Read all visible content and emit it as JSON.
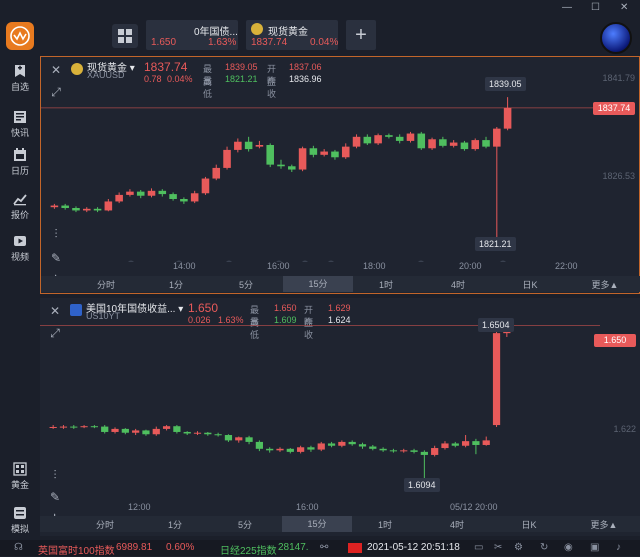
{
  "header": {
    "tabs": [
      {
        "name": "0年国债...",
        "price": "1.650",
        "change": "1.63%"
      },
      {
        "name": "现货黄金",
        "price": "1837.74",
        "change": "0.04%"
      }
    ],
    "add_label": "+"
  },
  "sidebar": {
    "items": [
      {
        "label": "自选",
        "icon": "bookmark-icon"
      },
      {
        "label": "快讯",
        "icon": "news-icon"
      },
      {
        "label": "日历",
        "icon": "calendar-icon"
      },
      {
        "label": "报价",
        "icon": "quote-chart-icon"
      },
      {
        "label": "视频",
        "icon": "video-play-icon"
      },
      {
        "label": "黄金",
        "icon": "gold-grid-icon"
      },
      {
        "label": "模拟",
        "icon": "simulate-icon"
      }
    ]
  },
  "panel1": {
    "name": "现货黄金",
    "code": "XAUUSD",
    "price": "1837.74",
    "change": "0.78",
    "change_pct": "0.04%",
    "high_label": "最高",
    "high": "1839.05",
    "open_label": "开盘",
    "open": "1837.06",
    "low_label": "最低",
    "low": "1821.21",
    "prev_label": "昨收",
    "prev": "1836.96",
    "tag": "1837.74",
    "callout_high": "1839.05",
    "callout_low": "1821.21",
    "axis": [
      "1841.79",
      "1826.53"
    ],
    "xticks": [
      "14:00",
      "16:00",
      "18:00",
      "20:00",
      "22:00"
    ]
  },
  "panel2": {
    "name": "美国10年国债收益...",
    "code": "US10YT",
    "price": "1.650",
    "change": "0.026",
    "change_pct": "1.63%",
    "high_label": "最高",
    "high": "1.650",
    "open_label": "开盘",
    "open": "1.629",
    "low_label": "最低",
    "low": "1.609",
    "prev_label": "昨收",
    "prev": "1.624",
    "tag": "1.650",
    "callout_high": "1.6504",
    "callout_low": "1.6094",
    "axis": [
      "1.622"
    ],
    "xticks": [
      "12:00",
      "16:00",
      "05/12 20:00"
    ]
  },
  "timeframes": [
    "分时",
    "1分",
    "5分",
    "15分",
    "1时",
    "4时",
    "日K",
    "更多▲"
  ],
  "status": {
    "idx1_name": "英国富时100指数",
    "idx1_val": "6989.81",
    "idx1_pct": "0.60%",
    "idx2_name": "日经225指数",
    "idx2_val": "28147.",
    "datetime": "2021-05-12 20:51:18"
  },
  "colors": {
    "up": "#e85a5a",
    "down": "#4fbf5f",
    "accent": "#e87a1f",
    "bg": "#1f2430"
  },
  "chart_data": [
    {
      "type": "candlestick",
      "code": "XAUUSD",
      "candles": [
        [
          1825.6,
          1825.8,
          1825.4,
          1826.0
        ],
        [
          1825.8,
          1825.5,
          1825.3,
          1826.0
        ],
        [
          1825.5,
          1825.2,
          1825.0,
          1825.7
        ],
        [
          1825.2,
          1825.4,
          1825.0,
          1825.6
        ],
        [
          1825.4,
          1825.2,
          1825.0,
          1825.6
        ],
        [
          1825.2,
          1826.3,
          1825.1,
          1826.6
        ],
        [
          1826.3,
          1827.1,
          1826.1,
          1827.4
        ],
        [
          1827.1,
          1827.5,
          1826.9,
          1827.8
        ],
        [
          1827.5,
          1827.0,
          1826.7,
          1827.7
        ],
        [
          1827.0,
          1827.6,
          1826.8,
          1827.9
        ],
        [
          1827.6,
          1827.2,
          1826.9,
          1827.8
        ],
        [
          1827.2,
          1826.6,
          1826.4,
          1827.4
        ],
        [
          1826.6,
          1826.3,
          1826.0,
          1826.8
        ],
        [
          1826.3,
          1827.3,
          1826.1,
          1827.6
        ],
        [
          1827.3,
          1829.1,
          1827.1,
          1829.3
        ],
        [
          1829.1,
          1830.4,
          1828.9,
          1830.8
        ],
        [
          1830.4,
          1832.6,
          1830.2,
          1833.0
        ],
        [
          1832.6,
          1833.6,
          1832.3,
          1834.0
        ],
        [
          1833.6,
          1832.7,
          1832.4,
          1834.2
        ],
        [
          1833.0,
          1833.2,
          1832.8,
          1833.7
        ],
        [
          1833.2,
          1830.8,
          1830.5,
          1833.4
        ],
        [
          1830.8,
          1830.6,
          1830.3,
          1831.4
        ],
        [
          1830.6,
          1830.2,
          1829.9,
          1830.8
        ],
        [
          1830.2,
          1832.8,
          1830.0,
          1833.0
        ],
        [
          1832.8,
          1832.0,
          1831.7,
          1833.1
        ],
        [
          1832.0,
          1832.4,
          1831.8,
          1832.7
        ],
        [
          1832.4,
          1831.7,
          1831.4,
          1832.6
        ],
        [
          1831.7,
          1833.0,
          1831.5,
          1833.4
        ],
        [
          1833.0,
          1834.2,
          1832.8,
          1834.5
        ],
        [
          1834.2,
          1833.4,
          1833.2,
          1834.5
        ],
        [
          1833.4,
          1834.4,
          1833.2,
          1834.6
        ],
        [
          1834.4,
          1834.2,
          1834.0,
          1834.6
        ],
        [
          1834.2,
          1833.7,
          1833.4,
          1834.5
        ],
        [
          1833.7,
          1834.6,
          1833.5,
          1834.8
        ],
        [
          1834.6,
          1832.8,
          1832.6,
          1834.8
        ],
        [
          1832.8,
          1833.9,
          1832.6,
          1834.1
        ],
        [
          1833.9,
          1833.1,
          1832.9,
          1834.2
        ],
        [
          1833.1,
          1833.5,
          1832.9,
          1833.8
        ],
        [
          1833.5,
          1832.7,
          1832.5,
          1833.7
        ],
        [
          1832.7,
          1833.8,
          1832.5,
          1834.0
        ],
        [
          1833.8,
          1833.0,
          1832.8,
          1834.2
        ],
        [
          1833.0,
          1835.2,
          1821.21,
          1835.4
        ],
        [
          1835.2,
          1837.74,
          1835.0,
          1839.05
        ]
      ],
      "ylim": [
        1820,
        1842
      ]
    },
    {
      "type": "candlestick",
      "code": "US10YT",
      "candles": [
        [
          1.6235,
          1.6235,
          1.623,
          1.624
        ],
        [
          1.6235,
          1.6236,
          1.623,
          1.624
        ],
        [
          1.6236,
          1.6235,
          1.623,
          1.624
        ],
        [
          1.6235,
          1.6237,
          1.6232,
          1.624
        ],
        [
          1.6237,
          1.6236,
          1.6232,
          1.624
        ],
        [
          1.6236,
          1.6222,
          1.6218,
          1.624
        ],
        [
          1.6222,
          1.623,
          1.6218,
          1.6234
        ],
        [
          1.623,
          1.622,
          1.6216,
          1.6232
        ],
        [
          1.622,
          1.6226,
          1.6214,
          1.623
        ],
        [
          1.6226,
          1.6216,
          1.6212,
          1.6228
        ],
        [
          1.6216,
          1.623,
          1.6212,
          1.6236
        ],
        [
          1.623,
          1.6237,
          1.6226,
          1.624
        ],
        [
          1.6237,
          1.6222,
          1.6218,
          1.624
        ],
        [
          1.6222,
          1.6218,
          1.6214,
          1.6224
        ],
        [
          1.6218,
          1.622,
          1.6214,
          1.6224
        ],
        [
          1.622,
          1.6216,
          1.6212,
          1.6222
        ],
        [
          1.6216,
          1.6214,
          1.621,
          1.622
        ],
        [
          1.6214,
          1.62,
          1.6196,
          1.6216
        ],
        [
          1.62,
          1.6208,
          1.6194,
          1.621
        ],
        [
          1.6208,
          1.6196,
          1.619,
          1.6212
        ],
        [
          1.6196,
          1.6178,
          1.6172,
          1.62
        ],
        [
          1.6178,
          1.6174,
          1.6168,
          1.6182
        ],
        [
          1.6174,
          1.6178,
          1.617,
          1.6182
        ],
        [
          1.6178,
          1.617,
          1.6166,
          1.618
        ],
        [
          1.617,
          1.6182,
          1.6166,
          1.6186
        ],
        [
          1.6182,
          1.6176,
          1.617,
          1.6186
        ],
        [
          1.6176,
          1.6192,
          1.6172,
          1.6196
        ],
        [
          1.6192,
          1.6186,
          1.6182,
          1.6196
        ],
        [
          1.6186,
          1.6196,
          1.6182,
          1.62
        ],
        [
          1.6196,
          1.619,
          1.6186,
          1.62
        ],
        [
          1.619,
          1.6184,
          1.6178,
          1.6194
        ],
        [
          1.6184,
          1.6178,
          1.6174,
          1.6188
        ],
        [
          1.6178,
          1.6174,
          1.617,
          1.6182
        ],
        [
          1.6174,
          1.6172,
          1.6168,
          1.6178
        ],
        [
          1.6172,
          1.6174,
          1.6168,
          1.6178
        ],
        [
          1.6174,
          1.617,
          1.6166,
          1.6178
        ],
        [
          1.617,
          1.6162,
          1.6094,
          1.6174
        ],
        [
          1.6162,
          1.618,
          1.6158,
          1.6186
        ],
        [
          1.618,
          1.6192,
          1.6176,
          1.6198
        ],
        [
          1.6192,
          1.6186,
          1.6182,
          1.6196
        ],
        [
          1.6186,
          1.6198,
          1.6182,
          1.6214
        ],
        [
          1.6198,
          1.6188,
          1.6164,
          1.6204
        ],
        [
          1.6188,
          1.62,
          1.6186,
          1.621
        ],
        [
          1.624,
          1.648,
          1.6235,
          1.649
        ],
        [
          1.648,
          1.65,
          1.647,
          1.6504
        ]
      ],
      "ylim": [
        1.606,
        1.653
      ]
    }
  ]
}
